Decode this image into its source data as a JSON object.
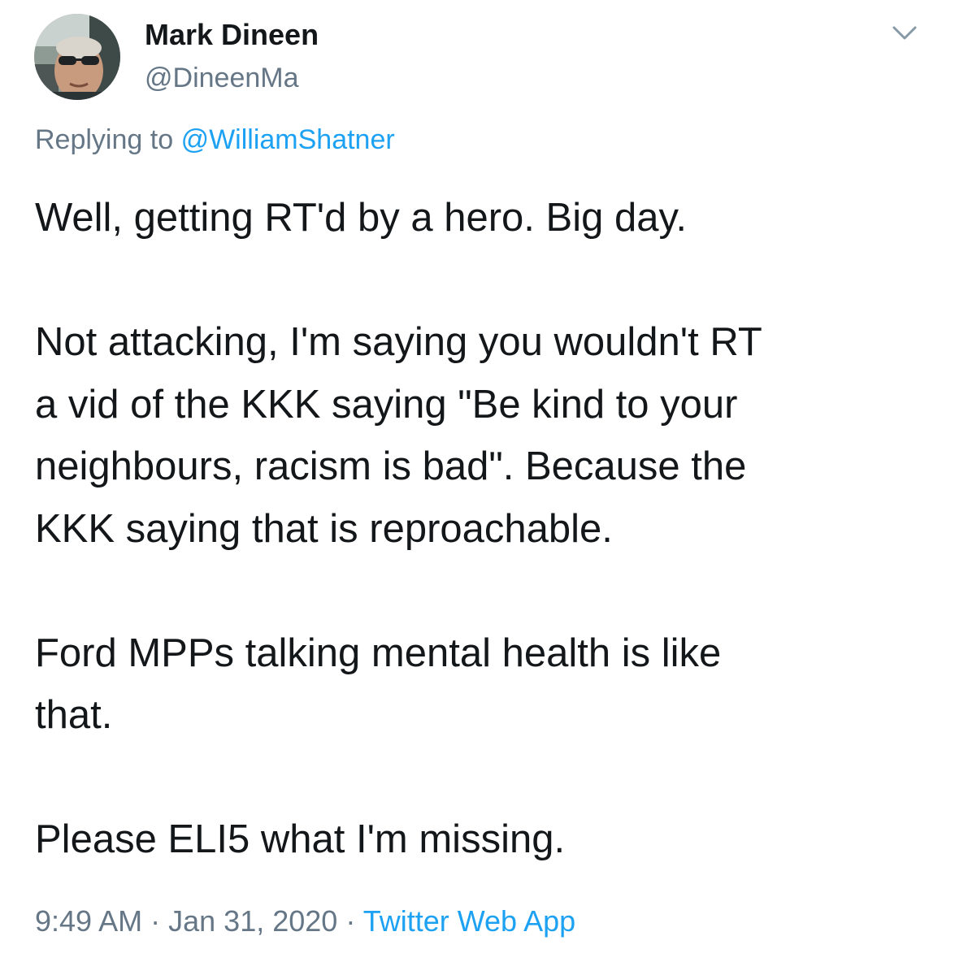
{
  "author": {
    "display_name": "Mark Dineen",
    "handle": "@DineenMa"
  },
  "reply": {
    "prefix": "Replying to",
    "mention": "@WilliamShatner"
  },
  "body": {
    "line1": "Well, getting RT'd by a hero. Big day.",
    "line2": "Not attacking, I'm saying you wouldn't RT",
    "line3": "a vid of the KKK saying \"Be kind to your",
    "line4": "neighbours, racism is bad\". Because the",
    "line5": "KKK saying that is reproachable.",
    "line6": "Ford MPPs talking mental health is like",
    "line7": "that.",
    "line8": "Please ELI5 what I'm missing."
  },
  "meta": {
    "time": "9:49 AM",
    "separator": "·",
    "date": "Jan 31, 2020",
    "source": "Twitter Web App"
  },
  "icons": {
    "avatar": "profile-photo",
    "menu": "chevron-down-icon"
  },
  "colors": {
    "text": "#14171a",
    "secondary": "#657786",
    "link": "#1da1f2"
  }
}
